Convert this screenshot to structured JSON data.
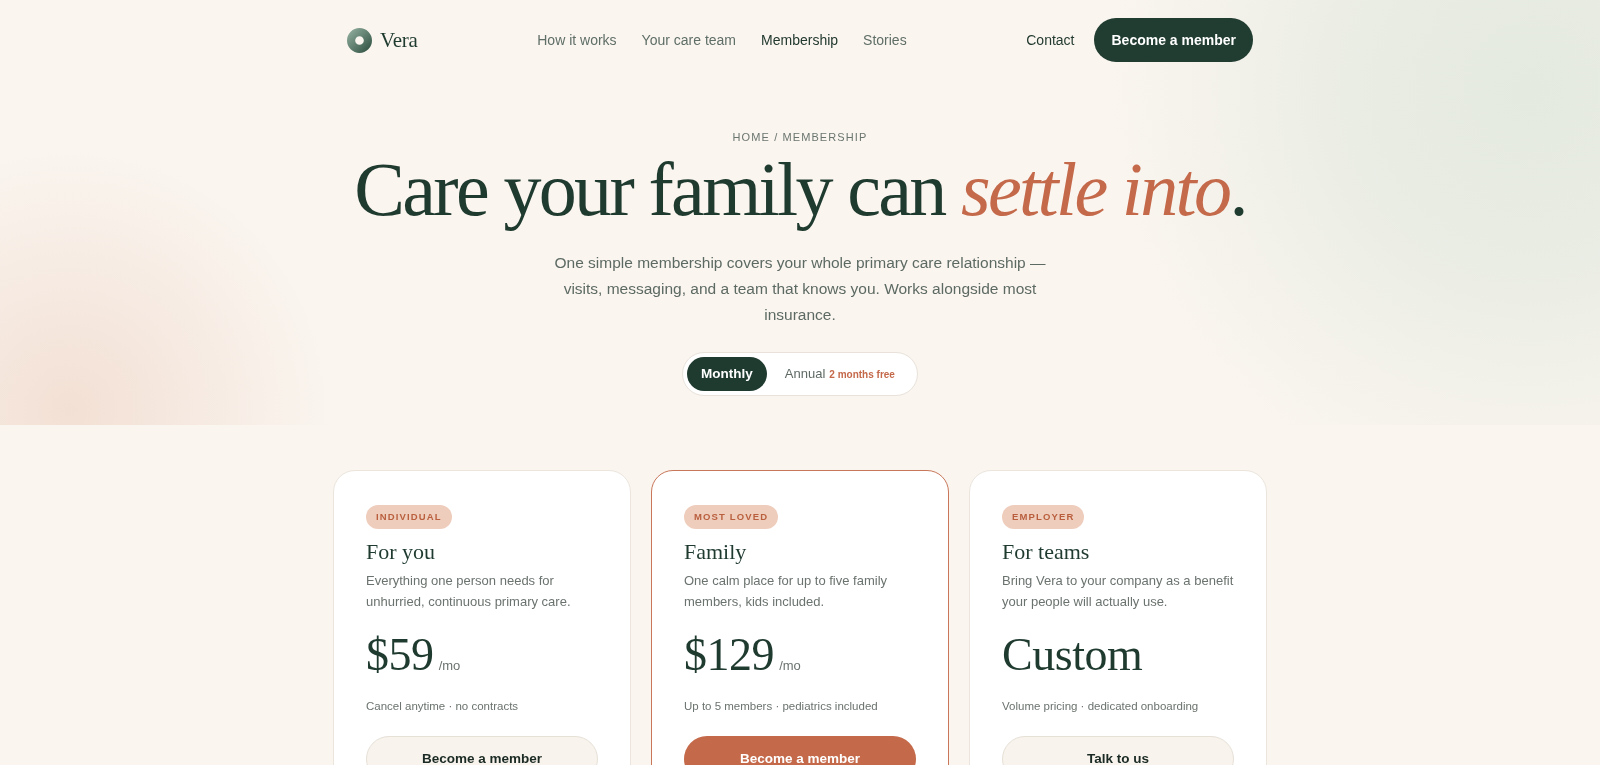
{
  "header": {
    "logo": "Vera",
    "nav": [
      {
        "label": "How it works",
        "selected": false
      },
      {
        "label": "Your care team",
        "selected": false
      },
      {
        "label": "Membership",
        "selected": true
      },
      {
        "label": "Stories",
        "selected": false
      }
    ],
    "contact": "Contact",
    "cta": "Become a member"
  },
  "hero": {
    "breadcrumb": "HOME / MEMBERSHIP",
    "title": "Care your family can *settle into*.",
    "description": "One simple membership covers your whole primary care relationship — visits, messaging, and a team that knows you. Works alongside most insurance.",
    "billing_toggle": [
      {
        "label": "Monthly",
        "selected": true
      },
      {
        "label": "Annual",
        "badge": "2 months free",
        "selected": false
      }
    ]
  },
  "plans": [
    {
      "badge": "INDIVIDUAL",
      "name": "For you",
      "description": "Everything one person needs for unhurried, continuous primary care.",
      "price": "$59",
      "period": "/mo",
      "note": "Cancel anytime · no contracts",
      "button": "Become a member",
      "featured": false
    },
    {
      "badge": "MOST LOVED",
      "name": "Family",
      "description": "One calm place for up to five family members, kids included.",
      "price": "$129",
      "period": "/mo",
      "note": "Up to 5 members · pediatrics included",
      "button": "Become a member",
      "featured": true
    },
    {
      "badge": "EMPLOYER",
      "name": "For teams",
      "description": "Bring Vera to your company as a benefit your people will actually use.",
      "price": "Custom",
      "note": "Volume pricing · dedicated onboarding",
      "button": "Talk to us",
      "featured": false
    }
  ]
}
